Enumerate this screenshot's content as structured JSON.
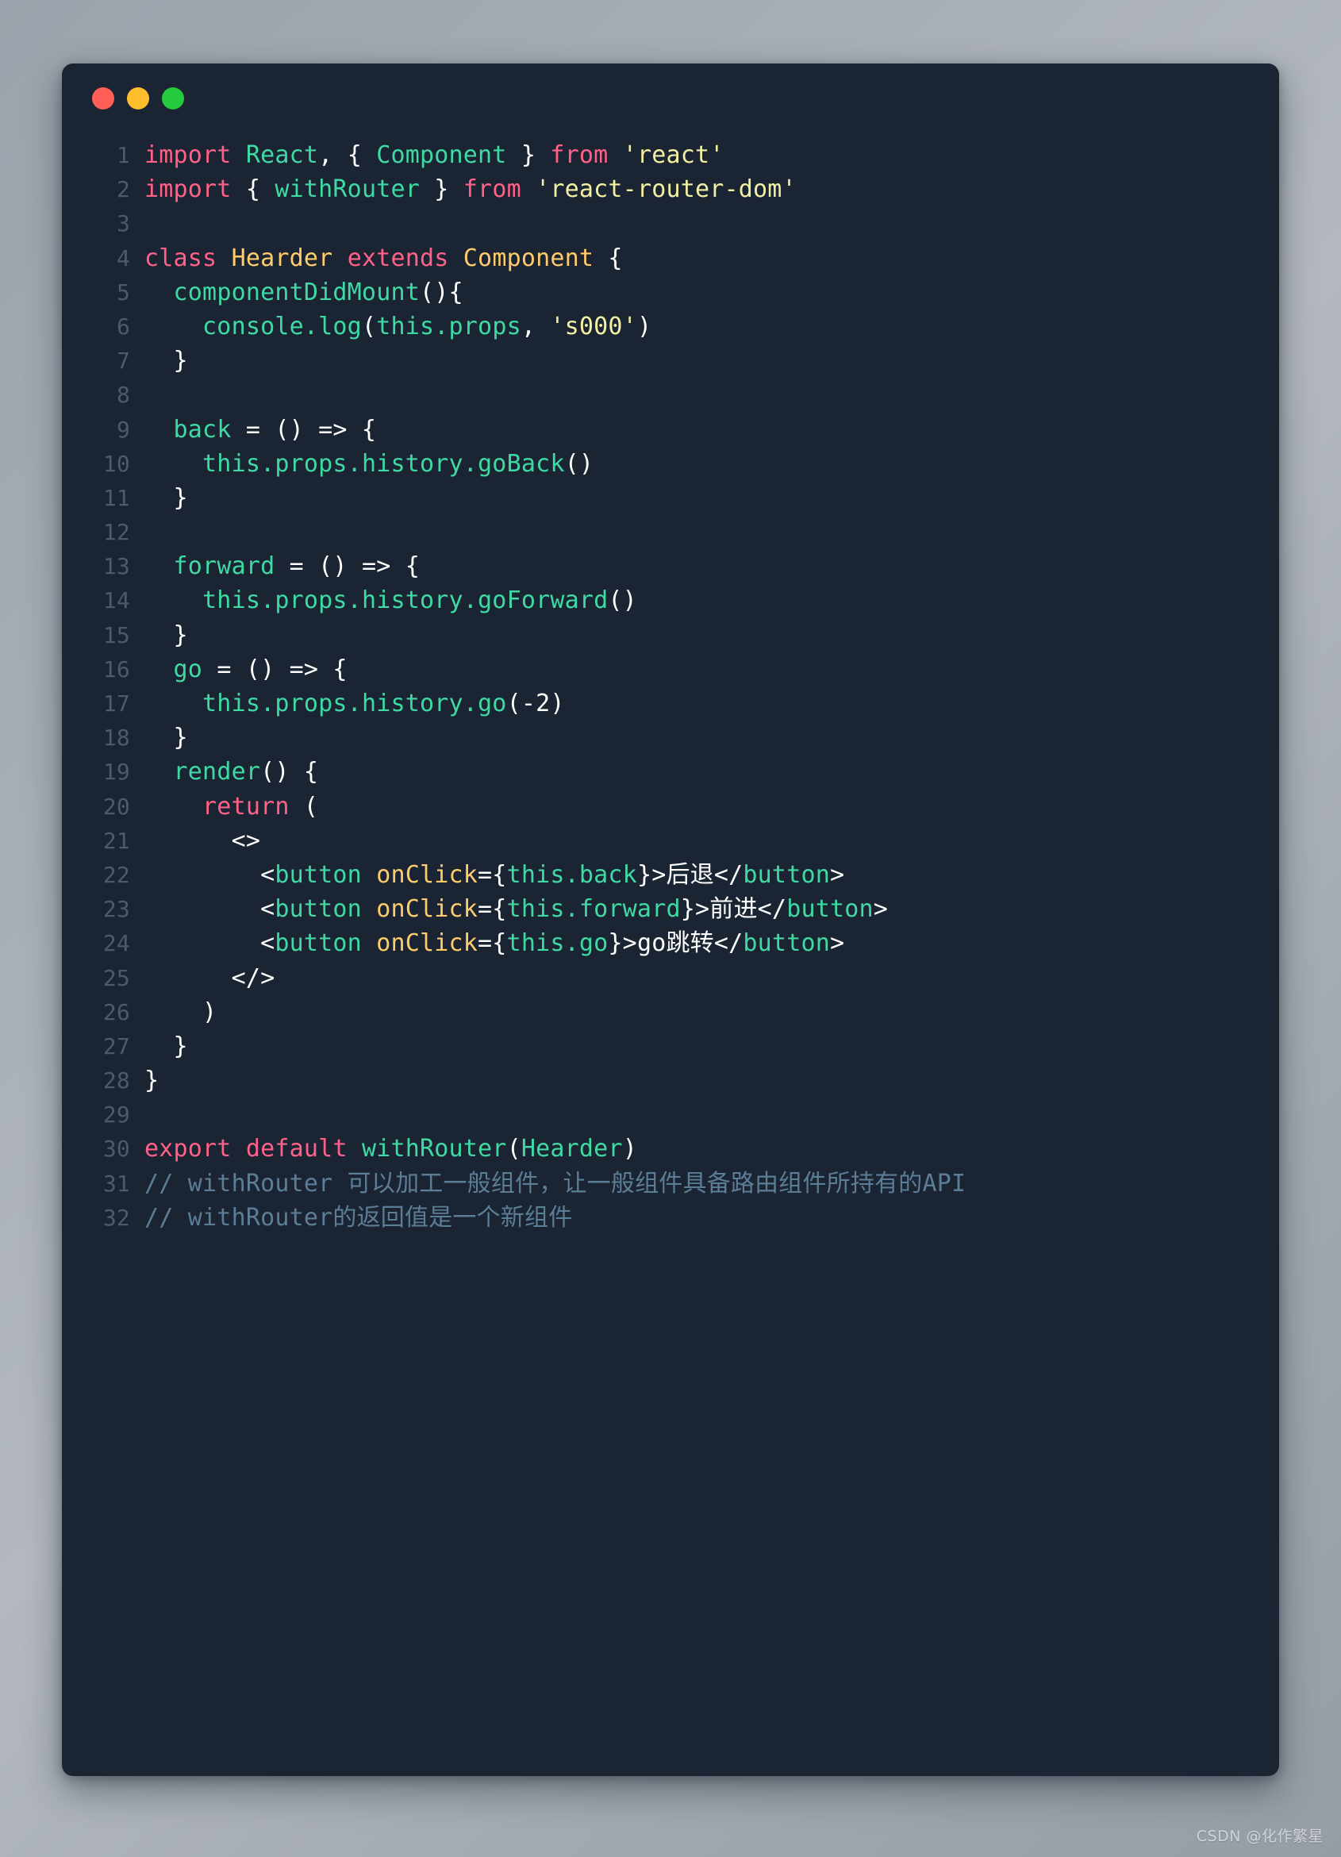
{
  "window": {
    "controls": [
      {
        "name": "close",
        "label": "close-button",
        "color": "#ff5f56"
      },
      {
        "name": "minimize",
        "label": "minimize-button",
        "color": "#ffbd2e"
      },
      {
        "name": "maximize",
        "label": "maximize-button",
        "color": "#27c93f"
      }
    ],
    "background": "#1b2432"
  },
  "theme": {
    "keyword": "#ff6188",
    "function": "#3fdaa4",
    "type": "#ffcc6b",
    "attribute": "#ffcc6b",
    "string": "#f2f0a4",
    "punctuation": "#ffffff",
    "comment": "#5b7d96",
    "line_number": "#4b5b6b",
    "editor_bg": "#1b2432"
  },
  "code": {
    "language": "jsx",
    "total_lines": 32,
    "lines": [
      {
        "n": "1",
        "tokens": [
          {
            "t": "import",
            "c": "kw"
          },
          {
            "t": " ",
            "c": "plain"
          },
          {
            "t": "React",
            "c": "fn"
          },
          {
            "t": ", ",
            "c": "punc"
          },
          {
            "t": "{ ",
            "c": "punc"
          },
          {
            "t": "Component",
            "c": "fn"
          },
          {
            "t": " } ",
            "c": "punc"
          },
          {
            "t": "from",
            "c": "kw"
          },
          {
            "t": " ",
            "c": "plain"
          },
          {
            "t": "'react'",
            "c": "str"
          }
        ]
      },
      {
        "n": "2",
        "tokens": [
          {
            "t": "import",
            "c": "kw"
          },
          {
            "t": " { ",
            "c": "punc"
          },
          {
            "t": "withRouter",
            "c": "fn"
          },
          {
            "t": " } ",
            "c": "punc"
          },
          {
            "t": "from",
            "c": "kw"
          },
          {
            "t": " ",
            "c": "plain"
          },
          {
            "t": "'react-router-dom'",
            "c": "str"
          }
        ]
      },
      {
        "n": "3",
        "tokens": []
      },
      {
        "n": "4",
        "tokens": [
          {
            "t": "class",
            "c": "kw"
          },
          {
            "t": " ",
            "c": "plain"
          },
          {
            "t": "Hearder",
            "c": "type"
          },
          {
            "t": " ",
            "c": "plain"
          },
          {
            "t": "extends",
            "c": "kw"
          },
          {
            "t": " ",
            "c": "plain"
          },
          {
            "t": "Component",
            "c": "type"
          },
          {
            "t": " {",
            "c": "punc"
          }
        ]
      },
      {
        "n": "5",
        "tokens": [
          {
            "t": "  ",
            "c": "plain"
          },
          {
            "t": "componentDidMount",
            "c": "fn"
          },
          {
            "t": "(){",
            "c": "punc"
          }
        ]
      },
      {
        "n": "6",
        "tokens": [
          {
            "t": "    ",
            "c": "plain"
          },
          {
            "t": "console",
            "c": "fn"
          },
          {
            "t": ".",
            "c": "fn"
          },
          {
            "t": "log",
            "c": "fn"
          },
          {
            "t": "(",
            "c": "punc"
          },
          {
            "t": "this",
            "c": "fn"
          },
          {
            "t": ".",
            "c": "fn"
          },
          {
            "t": "props",
            "c": "fn"
          },
          {
            "t": ", ",
            "c": "punc"
          },
          {
            "t": "'s000'",
            "c": "str"
          },
          {
            "t": ")",
            "c": "punc"
          }
        ]
      },
      {
        "n": "7",
        "tokens": [
          {
            "t": "  }",
            "c": "punc"
          }
        ]
      },
      {
        "n": "8",
        "tokens": []
      },
      {
        "n": "9",
        "tokens": [
          {
            "t": "  ",
            "c": "plain"
          },
          {
            "t": "back",
            "c": "fn"
          },
          {
            "t": " = () => {",
            "c": "punc"
          }
        ]
      },
      {
        "n": "10",
        "tokens": [
          {
            "t": "    ",
            "c": "plain"
          },
          {
            "t": "this",
            "c": "fn"
          },
          {
            "t": ".",
            "c": "fn"
          },
          {
            "t": "props",
            "c": "fn"
          },
          {
            "t": ".",
            "c": "fn"
          },
          {
            "t": "history",
            "c": "fn"
          },
          {
            "t": ".",
            "c": "fn"
          },
          {
            "t": "goBack",
            "c": "fn"
          },
          {
            "t": "()",
            "c": "punc"
          }
        ]
      },
      {
        "n": "11",
        "tokens": [
          {
            "t": "  }",
            "c": "punc"
          }
        ]
      },
      {
        "n": "12",
        "tokens": []
      },
      {
        "n": "13",
        "tokens": [
          {
            "t": "  ",
            "c": "plain"
          },
          {
            "t": "forward",
            "c": "fn"
          },
          {
            "t": " = () => {",
            "c": "punc"
          }
        ]
      },
      {
        "n": "14",
        "tokens": [
          {
            "t": "    ",
            "c": "plain"
          },
          {
            "t": "this",
            "c": "fn"
          },
          {
            "t": ".",
            "c": "fn"
          },
          {
            "t": "props",
            "c": "fn"
          },
          {
            "t": ".",
            "c": "fn"
          },
          {
            "t": "history",
            "c": "fn"
          },
          {
            "t": ".",
            "c": "fn"
          },
          {
            "t": "goForward",
            "c": "fn"
          },
          {
            "t": "()",
            "c": "punc"
          }
        ]
      },
      {
        "n": "15",
        "tokens": [
          {
            "t": "  }",
            "c": "punc"
          }
        ]
      },
      {
        "n": "16",
        "tokens": [
          {
            "t": "  ",
            "c": "plain"
          },
          {
            "t": "go",
            "c": "fn"
          },
          {
            "t": " = () => {",
            "c": "punc"
          }
        ]
      },
      {
        "n": "17",
        "tokens": [
          {
            "t": "    ",
            "c": "plain"
          },
          {
            "t": "this",
            "c": "fn"
          },
          {
            "t": ".",
            "c": "fn"
          },
          {
            "t": "props",
            "c": "fn"
          },
          {
            "t": ".",
            "c": "fn"
          },
          {
            "t": "history",
            "c": "fn"
          },
          {
            "t": ".",
            "c": "fn"
          },
          {
            "t": "go",
            "c": "fn"
          },
          {
            "t": "(-2)",
            "c": "punc"
          }
        ]
      },
      {
        "n": "18",
        "tokens": [
          {
            "t": "  }",
            "c": "punc"
          }
        ]
      },
      {
        "n": "19",
        "tokens": [
          {
            "t": "  ",
            "c": "plain"
          },
          {
            "t": "render",
            "c": "fn"
          },
          {
            "t": "() {",
            "c": "punc"
          }
        ]
      },
      {
        "n": "20",
        "tokens": [
          {
            "t": "    ",
            "c": "plain"
          },
          {
            "t": "return",
            "c": "kw"
          },
          {
            "t": " (",
            "c": "punc"
          }
        ]
      },
      {
        "n": "21",
        "tokens": [
          {
            "t": "      <>",
            "c": "punc"
          }
        ]
      },
      {
        "n": "22",
        "tokens": [
          {
            "t": "        <",
            "c": "punc"
          },
          {
            "t": "button",
            "c": "fn"
          },
          {
            "t": " ",
            "c": "plain"
          },
          {
            "t": "onClick",
            "c": "attr"
          },
          {
            "t": "={",
            "c": "punc"
          },
          {
            "t": "this",
            "c": "fn"
          },
          {
            "t": ".",
            "c": "fn"
          },
          {
            "t": "back",
            "c": "fn"
          },
          {
            "t": "}>",
            "c": "punc"
          },
          {
            "t": "后退",
            "c": "plain cjk"
          },
          {
            "t": "</",
            "c": "punc"
          },
          {
            "t": "button",
            "c": "fn"
          },
          {
            "t": ">",
            "c": "punc"
          }
        ]
      },
      {
        "n": "23",
        "tokens": [
          {
            "t": "        <",
            "c": "punc"
          },
          {
            "t": "button",
            "c": "fn"
          },
          {
            "t": " ",
            "c": "plain"
          },
          {
            "t": "onClick",
            "c": "attr"
          },
          {
            "t": "={",
            "c": "punc"
          },
          {
            "t": "this",
            "c": "fn"
          },
          {
            "t": ".",
            "c": "fn"
          },
          {
            "t": "forward",
            "c": "fn"
          },
          {
            "t": "}>",
            "c": "punc"
          },
          {
            "t": "前进",
            "c": "plain cjk"
          },
          {
            "t": "</",
            "c": "punc"
          },
          {
            "t": "button",
            "c": "fn"
          },
          {
            "t": ">",
            "c": "punc"
          }
        ]
      },
      {
        "n": "24",
        "tokens": [
          {
            "t": "        <",
            "c": "punc"
          },
          {
            "t": "button",
            "c": "fn"
          },
          {
            "t": " ",
            "c": "plain"
          },
          {
            "t": "onClick",
            "c": "attr"
          },
          {
            "t": "={",
            "c": "punc"
          },
          {
            "t": "this",
            "c": "fn"
          },
          {
            "t": ".",
            "c": "fn"
          },
          {
            "t": "go",
            "c": "fn"
          },
          {
            "t": "}>",
            "c": "punc"
          },
          {
            "t": "go",
            "c": "plain"
          },
          {
            "t": "跳转",
            "c": "plain cjk"
          },
          {
            "t": "</",
            "c": "punc"
          },
          {
            "t": "button",
            "c": "fn"
          },
          {
            "t": ">",
            "c": "punc"
          }
        ]
      },
      {
        "n": "25",
        "tokens": [
          {
            "t": "      </>",
            "c": "punc"
          }
        ]
      },
      {
        "n": "26",
        "tokens": [
          {
            "t": "    )",
            "c": "punc"
          }
        ]
      },
      {
        "n": "27",
        "tokens": [
          {
            "t": "  }",
            "c": "punc"
          }
        ]
      },
      {
        "n": "28",
        "tokens": [
          {
            "t": "}",
            "c": "punc"
          }
        ]
      },
      {
        "n": "29",
        "tokens": []
      },
      {
        "n": "30",
        "tokens": [
          {
            "t": "export",
            "c": "kw"
          },
          {
            "t": " ",
            "c": "plain"
          },
          {
            "t": "default",
            "c": "kw"
          },
          {
            "t": " ",
            "c": "plain"
          },
          {
            "t": "withRouter",
            "c": "fn"
          },
          {
            "t": "(",
            "c": "punc"
          },
          {
            "t": "Hearder",
            "c": "fn"
          },
          {
            "t": ")",
            "c": "punc"
          }
        ]
      },
      {
        "n": "31",
        "tokens": [
          {
            "t": "// withRouter ",
            "c": "comment"
          },
          {
            "t": "可以加工一般组件，让一般组件具备路由组件所持有的",
            "c": "comment cjk"
          },
          {
            "t": "API",
            "c": "comment"
          }
        ]
      },
      {
        "n": "32",
        "tokens": [
          {
            "t": "// withRouter",
            "c": "comment"
          },
          {
            "t": "的返回值是一个新组件",
            "c": "comment cjk"
          }
        ]
      }
    ]
  },
  "watermark": {
    "text": "CSDN @化作繁星"
  }
}
